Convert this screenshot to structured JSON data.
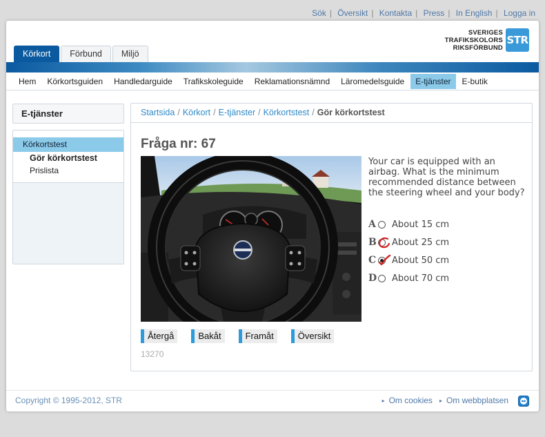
{
  "toplinks": [
    "Sök",
    "Översikt",
    "Kontakta",
    "Press",
    "In English",
    "Logga in"
  ],
  "logo": {
    "line1": "SVERIGES",
    "line2": "TRAFIKSKOLORS",
    "line3": "RIKSFÖRBUND",
    "badge": "STR",
    "color": "#3a9ad9"
  },
  "tabs": [
    {
      "label": "Körkort",
      "active": true
    },
    {
      "label": "Förbund",
      "active": false
    },
    {
      "label": "Miljö",
      "active": false
    }
  ],
  "nav": [
    {
      "label": "Hem"
    },
    {
      "label": "Körkortsguiden"
    },
    {
      "label": "Handledarguide"
    },
    {
      "label": "Trafikskoleguide"
    },
    {
      "label": "Reklamationsnämnd"
    },
    {
      "label": "Läromedelsguide"
    },
    {
      "label": "E-tjänster",
      "active": true
    },
    {
      "label": "E-butik"
    }
  ],
  "sidebar": {
    "title": "E-tjänster",
    "item": "Körkortstest",
    "sub1": "Gör körkortstest",
    "sub2": "Prislista"
  },
  "breadcrumb": {
    "items": [
      "Startsida",
      "Körkort",
      "E-tjänster",
      "Körkortstest"
    ],
    "current": "Gör körkortstest"
  },
  "question": {
    "title": "Fråga nr: 67",
    "text": "Your car is equipped with an airbag. What is the minimum recommended distance between the steering wheel and your body?",
    "answers": [
      {
        "letter": "A",
        "text": "About 15 cm",
        "checked": false
      },
      {
        "letter": "B",
        "text": "About 25 cm",
        "checked": false
      },
      {
        "letter": "C",
        "text": "About 50 cm",
        "checked": true
      },
      {
        "letter": "D",
        "text": "About 70 cm",
        "checked": false
      }
    ],
    "id": "13270"
  },
  "buttons": [
    "Återgå",
    "Bakåt",
    "Framåt",
    "Översikt"
  ],
  "footer": {
    "copyright": "Copyright © 1995-2012, STR",
    "links": [
      "Om cookies",
      "Om webbplatsen"
    ]
  },
  "colors": {
    "brand_blue": "#0b5aa0",
    "active_tab": "#8ccaea",
    "link": "#2f8ac8",
    "button_accent": "#2c9bdc",
    "handwritten_mark": "#d42020"
  }
}
